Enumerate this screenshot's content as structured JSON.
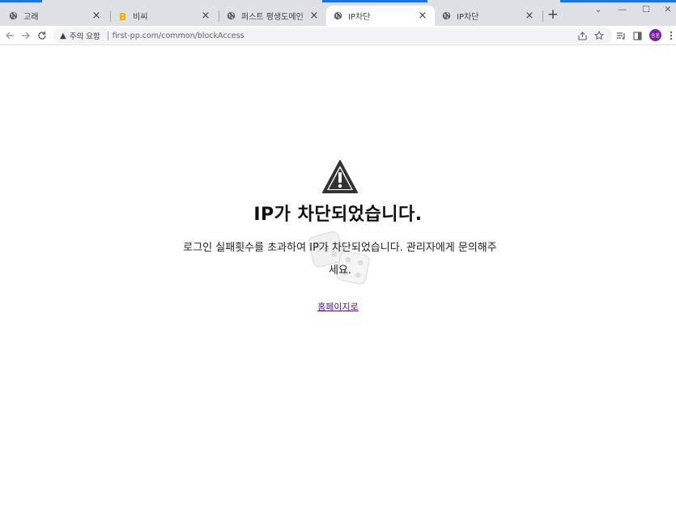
{
  "tabs": [
    {
      "title": "고래",
      "favicon": "globe-icon",
      "active": false
    },
    {
      "title": "비씨",
      "favicon": "b-logo-icon",
      "active": false
    },
    {
      "title": "퍼스트 평생도메인",
      "favicon": "globe-icon",
      "active": false
    },
    {
      "title": "IP차단",
      "favicon": "globe-icon",
      "active": true
    },
    {
      "title": "IP차단",
      "favicon": "globe-icon",
      "active": false
    }
  ],
  "new_tab": "+",
  "window_controls": {
    "chevron": "⌄",
    "minimize": "—",
    "maximize": "☐",
    "close": "✕"
  },
  "toolbar": {
    "security_label": "주의 요함",
    "url": "first-pp.com/common/blockAccess",
    "profile_initials": "송훈"
  },
  "page": {
    "heading": "IP가 차단되었습니다.",
    "message_line1": "로그인 실패횟수를 초과하여 IP가 차단되었습니다. 관리자에게 문의해주",
    "message_line2": "세요.",
    "home_link": "홈페이지로"
  },
  "colors": {
    "accent": "#1a73e8",
    "link": "#4a148c",
    "profile": "#7b1fa2"
  }
}
